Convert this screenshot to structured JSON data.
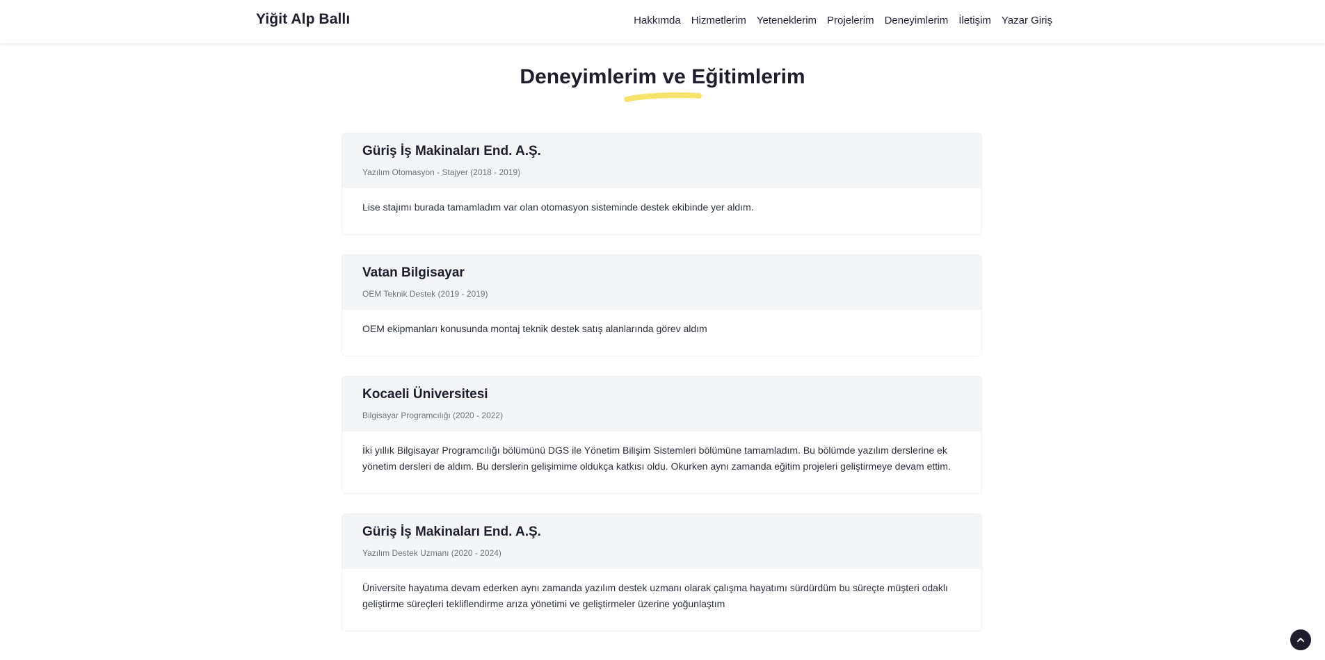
{
  "header": {
    "brand": "Yiğit Alp Ballı",
    "nav": [
      {
        "label": "Hakkımda"
      },
      {
        "label": "Hizmetlerim"
      },
      {
        "label": "Yeteneklerim"
      },
      {
        "label": "Projelerim"
      },
      {
        "label": "Deneyimlerim"
      },
      {
        "label": "İletişim"
      },
      {
        "label": "Yazar Giriş"
      }
    ]
  },
  "section": {
    "title": "Deneyimlerim ve Eğitimlerim",
    "underline_color": "#f7e36b"
  },
  "experiences": [
    {
      "organization": "Güriş İş Makinaları End. A.Ş.",
      "role": "Yazılım Otomasyon - Stajyer (2018 - 2019)",
      "description": "Lise stajımı burada tamamladım var olan otomasyon sisteminde destek ekibinde yer aldım."
    },
    {
      "organization": "Vatan Bilgisayar",
      "role": "OEM Teknik Destek (2019 - 2019)",
      "description": "OEM ekipmanları konusunda montaj teknik destek satış alanlarında görev aldım"
    },
    {
      "organization": "Kocaeli Üniversitesi",
      "role": "Bilgisayar Programcılığı (2020 - 2022)",
      "description": "İki yıllık Bilgisayar Programcılığı bölümünü DGS ile Yönetim Bilişim Sistemleri bölümüne tamamladım. Bu bölümde yazılım derslerine ek yönetim dersleri de aldım. Bu derslerin gelişimime oldukça katkısı oldu. Okurken aynı zamanda eğitim projeleri geliştirmeye devam ettim."
    },
    {
      "organization": "Güriş İş Makinaları End. A.Ş.",
      "role": "Yazılım Destek Uzmanı (2020 - 2024)",
      "description": "Üniversite hayatıma devam ederken aynı zamanda yazılım destek uzmanı olarak çalışma hayatımı sürdürdüm bu süreçte müşteri odaklı geliştirme süreçleri tekliflendirme arıza yönetimi ve geliştirmeler üzerine yoğunlaştım"
    }
  ],
  "scroll_top": {
    "icon": "chevron-up-icon"
  }
}
